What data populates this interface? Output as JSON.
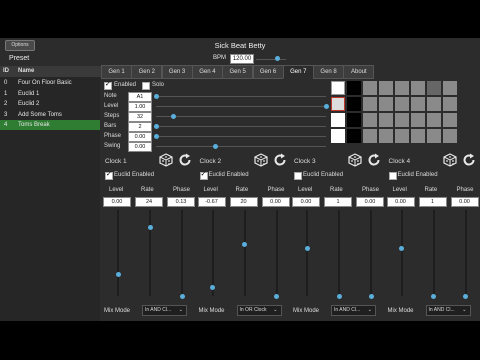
{
  "titlebar": {
    "options_label": "Options",
    "title": "Sick Beat Betty"
  },
  "header": {
    "bpm_label": "BPM",
    "bpm_value": "120.00",
    "bpm_fraction": 0.7,
    "preset_label": "Preset"
  },
  "presets": {
    "columns": [
      "ID",
      "Name"
    ],
    "rows": [
      {
        "id": "0",
        "name": "Four On Floor Basic"
      },
      {
        "id": "1",
        "name": "Euclid 1"
      },
      {
        "id": "2",
        "name": "Euclid 2"
      },
      {
        "id": "3",
        "name": "Add Some Toms"
      },
      {
        "id": "4",
        "name": "Toms Break"
      }
    ],
    "selected": 4
  },
  "tabs": [
    "Gen 1",
    "Gen 2",
    "Gen 3",
    "Gen 4",
    "Gen 5",
    "Gen 6",
    "Gen 7",
    "Gen 8",
    "About"
  ],
  "active_tab": 6,
  "generator": {
    "enabled_label": "Enabled",
    "enabled": true,
    "solo_label": "Solo",
    "solo": false,
    "params": [
      {
        "label": "Note",
        "value": "A1",
        "fraction": 0.0
      },
      {
        "label": "Level",
        "value": "1.00",
        "fraction": 1.0
      },
      {
        "label": "Steps",
        "value": "32",
        "fraction": 0.1
      },
      {
        "label": "Bars",
        "value": "2",
        "fraction": 0.0
      },
      {
        "label": "Phase",
        "value": "0.00",
        "fraction": 0.0
      },
      {
        "label": "Swing",
        "value": "0.00",
        "fraction": 0.35
      }
    ]
  },
  "grid": {
    "rows": [
      [
        "selected",
        "black",
        "gray",
        "gray",
        "gray",
        "gray",
        "dark",
        "gray"
      ],
      [
        "selected-red",
        "black",
        "gray",
        "gray",
        "gray",
        "gray",
        "gray",
        "gray"
      ],
      [
        "white",
        "black",
        "gray",
        "gray",
        "gray",
        "gray",
        "gray",
        "gray"
      ],
      [
        "white",
        "black",
        "gray",
        "gray",
        "gray",
        "gray",
        "gray",
        "gray"
      ]
    ],
    "colors": {
      "white": "#ffffff",
      "black": "#000000",
      "gray": "#8a8a8a",
      "dark": "#666666",
      "red": "#c0392b"
    }
  },
  "clocks": [
    {
      "label": "Clock 1",
      "euclid_label": "Euclid Enabled",
      "euclid": true,
      "level": "0.00",
      "rate": "24",
      "phase": "0.13",
      "level_fraction": 0.25,
      "rate_fraction": 0.8,
      "phase_fraction": 0.0,
      "mix_label": "Mix Mode",
      "mix_value": "In AND Cl..."
    },
    {
      "label": "Clock 2",
      "euclid_label": "Euclid Enabled",
      "euclid": true,
      "level": "-0.67",
      "rate": "20",
      "phase": "0.00",
      "level_fraction": 0.1,
      "rate_fraction": 0.6,
      "phase_fraction": 0.0,
      "mix_label": "Mix Mode",
      "mix_value": "In OR Clock"
    },
    {
      "label": "Clock 3",
      "euclid_label": "Euclid Enabled",
      "euclid": false,
      "level": "0.00",
      "rate": "1",
      "phase": "0.00",
      "level_fraction": 0.55,
      "rate_fraction": 0.0,
      "phase_fraction": 0.0,
      "mix_label": "Mix Mode",
      "mix_value": "In AND Cl..."
    },
    {
      "label": "Clock 4",
      "euclid_label": "Euclid Enabled",
      "euclid": false,
      "level": "0.00",
      "rate": "1",
      "phase": "0.00",
      "level_fraction": 0.55,
      "rate_fraction": 0.0,
      "phase_fraction": 0.0,
      "mix_label": "Mix Mode",
      "mix_value": "In AND Cl..."
    }
  ],
  "clock_param_labels": [
    "Level",
    "Rate",
    "Phase"
  ],
  "icons": {
    "dice": "dice-icon",
    "reset": "reset-icon",
    "checkmark": "check-icon",
    "dropdown": "chevron-down-icon"
  }
}
